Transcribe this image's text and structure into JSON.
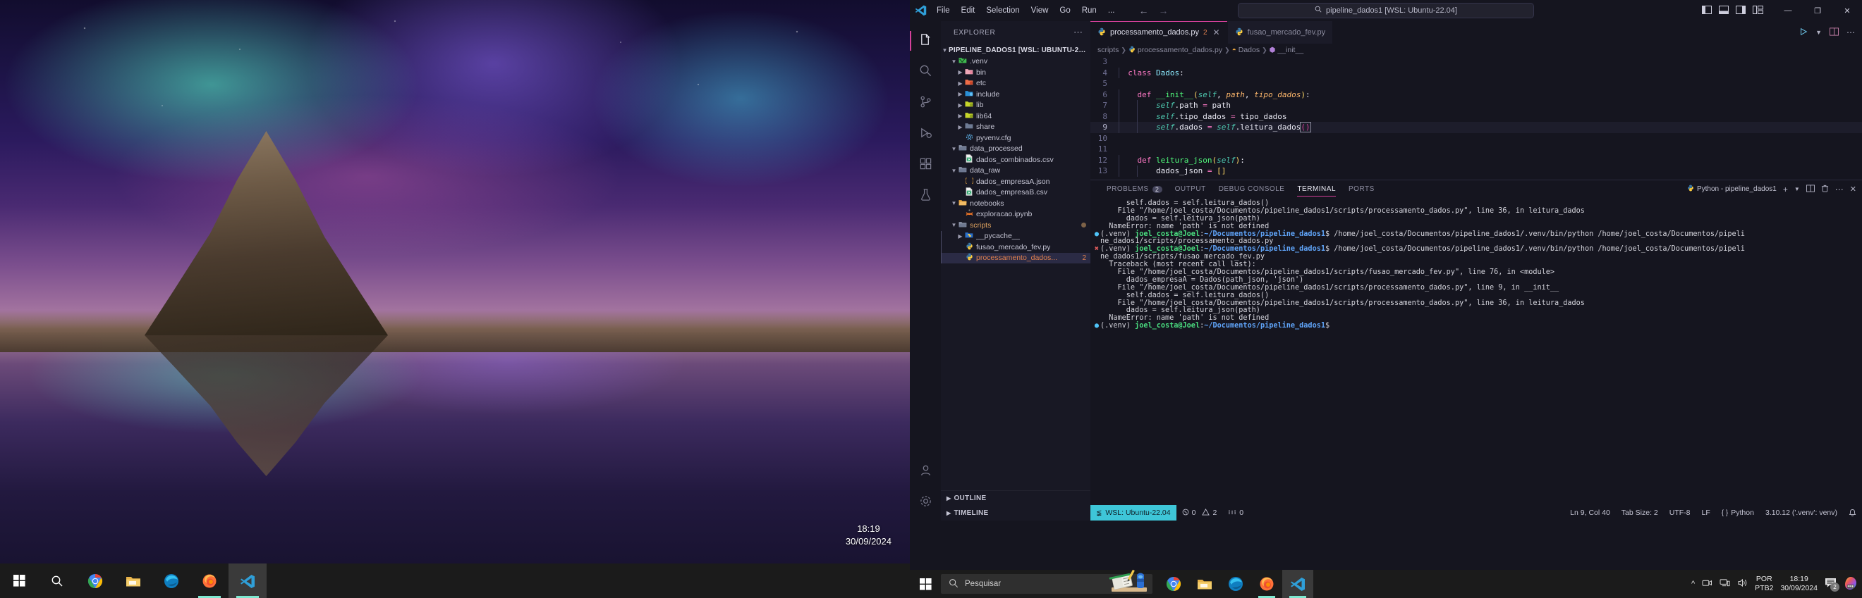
{
  "desktop": {
    "clock_time": "18:19",
    "clock_date": "30/09/2024",
    "taskbar_icons": [
      "windows-start-icon",
      "search-icon",
      "chrome-icon",
      "file-explorer-icon",
      "edge-icon",
      "firefox-icon",
      "vscode-icon"
    ]
  },
  "titlebar": {
    "menu": [
      "File",
      "Edit",
      "Selection",
      "View",
      "Go",
      "Run",
      "..."
    ],
    "search_value": "pipeline_dados1 [WSL: Ubuntu-22.04]",
    "back_icon": "arrow-left-icon",
    "forward_icon": "arrow-right-icon",
    "layout_icons": [
      "toggle-primary-sidebar-icon",
      "toggle-panel-icon",
      "toggle-secondary-sidebar-icon",
      "customize-layout-icon"
    ],
    "minimize": "—",
    "maximize": "❐",
    "close": "✕"
  },
  "activitybar": {
    "items": [
      {
        "name": "explorer",
        "icon": "files-icon",
        "active": true
      },
      {
        "name": "search",
        "icon": "search-icon",
        "active": false
      },
      {
        "name": "source-control",
        "icon": "source-control-icon",
        "active": false
      },
      {
        "name": "run-debug",
        "icon": "run-debug-icon",
        "active": false
      },
      {
        "name": "extensions",
        "icon": "extensions-icon",
        "active": false
      },
      {
        "name": "testing",
        "icon": "beaker-icon",
        "active": false
      }
    ],
    "bottom": [
      {
        "name": "accounts",
        "icon": "account-icon"
      },
      {
        "name": "settings",
        "icon": "gear-icon"
      }
    ]
  },
  "sidebar": {
    "title": "EXPLORER",
    "more_icon": "ellipsis-icon",
    "root": "PIPELINE_DADOS1 [WSL: UBUNTU-22....",
    "tree": [
      {
        "label": ".venv",
        "icon": "folder-venv",
        "indent": 1,
        "expanded": true,
        "type": "folder"
      },
      {
        "label": "bin",
        "icon": "folder-bin",
        "indent": 2,
        "expanded": false,
        "type": "folder"
      },
      {
        "label": "etc",
        "icon": "folder-etc",
        "indent": 2,
        "expanded": false,
        "type": "folder"
      },
      {
        "label": "include",
        "icon": "folder-include",
        "indent": 2,
        "expanded": false,
        "type": "folder"
      },
      {
        "label": "lib",
        "icon": "folder-lib",
        "indent": 2,
        "expanded": false,
        "type": "folder"
      },
      {
        "label": "lib64",
        "icon": "folder-lib",
        "indent": 2,
        "expanded": false,
        "type": "folder"
      },
      {
        "label": "share",
        "icon": "folder-share",
        "indent": 2,
        "expanded": false,
        "type": "folder"
      },
      {
        "label": "pyvenv.cfg",
        "icon": "gear-file-icon",
        "indent": 2,
        "type": "file"
      },
      {
        "label": "data_processed",
        "icon": "folder-open",
        "indent": 1,
        "expanded": true,
        "type": "folder"
      },
      {
        "label": "dados_combinados.csv",
        "icon": "csv-icon",
        "indent": 2,
        "type": "file"
      },
      {
        "label": "data_raw",
        "icon": "folder-open",
        "indent": 1,
        "expanded": true,
        "type": "folder"
      },
      {
        "label": "dados_empresaA.json",
        "icon": "json-icon",
        "indent": 2,
        "type": "file"
      },
      {
        "label": "dados_empresaB.csv",
        "icon": "csv-icon",
        "indent": 2,
        "type": "file"
      },
      {
        "label": "notebooks",
        "icon": "folder-notebook",
        "indent": 1,
        "expanded": true,
        "type": "folder"
      },
      {
        "label": "exploracao.ipynb",
        "icon": "jupyter-icon",
        "indent": 2,
        "type": "file"
      },
      {
        "label": "scripts",
        "icon": "folder-scripts",
        "indent": 1,
        "expanded": true,
        "type": "folder",
        "modified": true
      },
      {
        "label": "__pycache__",
        "icon": "folder-pycache",
        "indent": 2,
        "expanded": false,
        "type": "folder"
      },
      {
        "label": "fusao_mercado_fev.py",
        "icon": "python-icon",
        "indent": 2,
        "type": "file"
      },
      {
        "label": "processamento_dados...",
        "icon": "python-icon",
        "indent": 2,
        "type": "file",
        "selected": true,
        "errors": "2"
      }
    ],
    "sections": [
      {
        "label": "OUTLINE",
        "expanded": false
      },
      {
        "label": "TIMELINE",
        "expanded": false
      }
    ]
  },
  "tabs": [
    {
      "label": "processamento_dados.py",
      "icon": "python-icon",
      "badge": "2",
      "active": true,
      "close": "✕"
    },
    {
      "label": "fusao_mercado_fev.py",
      "icon": "python-icon",
      "active": false
    }
  ],
  "tabs_actions": [
    "run-python-file-icon",
    "chevron-down-icon",
    "split-editor-icon",
    "ellipsis-icon"
  ],
  "breadcrumb": [
    "scripts",
    "processamento_dados.py",
    "Dados",
    "__init__"
  ],
  "code": {
    "lines": [
      {
        "no": "3",
        "tokens": []
      },
      {
        "no": "4",
        "tokens": [
          {
            "t": "class ",
            "c": "t-kw"
          },
          {
            "t": "Dados",
            "c": "t-cls"
          },
          {
            "t": ":",
            "c": "t-pn"
          }
        ],
        "indent": "  "
      },
      {
        "no": "5",
        "tokens": []
      },
      {
        "no": "6",
        "tokens": [
          {
            "t": "def ",
            "c": "t-kw"
          },
          {
            "t": "__init__",
            "c": "t-fn"
          },
          {
            "t": "(",
            "c": "t-b1"
          },
          {
            "t": "self",
            "c": "t-self"
          },
          {
            "t": ", ",
            "c": "t-pn"
          },
          {
            "t": "path",
            "c": "t-par"
          },
          {
            "t": ", ",
            "c": "t-pn"
          },
          {
            "t": "tipo_dados",
            "c": "t-par"
          },
          {
            "t": ")",
            "c": "t-b1"
          },
          {
            "t": ":",
            "c": "t-pn"
          }
        ],
        "indent": "    "
      },
      {
        "no": "7",
        "tokens": [
          {
            "t": "self",
            "c": "t-self"
          },
          {
            "t": ".path ",
            "c": "t-pl"
          },
          {
            "t": "= ",
            "c": "t-op"
          },
          {
            "t": "path",
            "c": "t-pl"
          }
        ],
        "indent": "        "
      },
      {
        "no": "8",
        "tokens": [
          {
            "t": "self",
            "c": "t-self"
          },
          {
            "t": ".tipo_dados ",
            "c": "t-pl"
          },
          {
            "t": "= ",
            "c": "t-op"
          },
          {
            "t": "tipo_dados",
            "c": "t-pl"
          }
        ],
        "indent": "        "
      },
      {
        "no": "9",
        "tokens": [
          {
            "t": "self",
            "c": "t-self"
          },
          {
            "t": ".dados ",
            "c": "t-pl"
          },
          {
            "t": "= ",
            "c": "t-op"
          },
          {
            "t": "self",
            "c": "t-self"
          },
          {
            "t": ".leitura_dados",
            "c": "t-pl"
          }
        ],
        "indent": "        ",
        "cursor": "()",
        "current": true
      },
      {
        "no": "10",
        "tokens": []
      },
      {
        "no": "11",
        "tokens": []
      },
      {
        "no": "12",
        "tokens": [
          {
            "t": "def ",
            "c": "t-kw"
          },
          {
            "t": "leitura_json",
            "c": "t-fn"
          },
          {
            "t": "(",
            "c": "t-b1"
          },
          {
            "t": "self",
            "c": "t-self"
          },
          {
            "t": ")",
            "c": "t-b1"
          },
          {
            "t": ":",
            "c": "t-pn"
          }
        ],
        "indent": "    "
      },
      {
        "no": "13",
        "tokens": [
          {
            "t": "dados_json ",
            "c": "t-pl"
          },
          {
            "t": "= ",
            "c": "t-op"
          },
          {
            "t": "[]",
            "c": "t-b1"
          }
        ],
        "indent": "        "
      }
    ]
  },
  "panel": {
    "tabs": [
      {
        "label": "PROBLEMS",
        "badge": "2",
        "active": false
      },
      {
        "label": "OUTPUT",
        "active": false
      },
      {
        "label": "DEBUG CONSOLE",
        "active": false
      },
      {
        "label": "TERMINAL",
        "active": true
      },
      {
        "label": "PORTS",
        "active": false
      }
    ],
    "terminal_selector": "Python - pipeline_dados1",
    "actions": [
      "new-terminal-icon",
      "split-terminal-icon",
      "kill-terminal-icon",
      "ellipsis-icon",
      "close-panel-icon"
    ]
  },
  "terminal": {
    "lines": [
      {
        "gutter": "",
        "segs": [
          {
            "t": "      self.dados = self.leitura_dados()"
          }
        ]
      },
      {
        "gutter": "",
        "segs": [
          {
            "t": "    File \"/home/joel_costa/Documentos/pipeline_dados1/scripts/processamento_dados.py\", line 36, in leitura_dados"
          }
        ]
      },
      {
        "gutter": "",
        "segs": [
          {
            "t": "      dados = self.leitura_json(path)"
          }
        ]
      },
      {
        "gutter": "",
        "segs": [
          {
            "t": "  NameError: name 'path' is not defined"
          }
        ]
      },
      {
        "gutter": "ok",
        "segs": [
          {
            "t": "(.venv) ",
            "c": "t-venv"
          },
          {
            "t": "joel_costa@Joel",
            "c": "t-user"
          },
          {
            "t": ":",
            "c": ""
          },
          {
            "t": "~/Documentos/pipeline_dados1",
            "c": "t-path"
          },
          {
            "t": "$ /home/joel_costa/Documentos/pipeline_dados1/.venv/bin/python /home/joel_costa/Documentos/pipeli"
          }
        ]
      },
      {
        "gutter": "",
        "segs": [
          {
            "t": "ne_dados1/scripts/processamento_dados.py"
          }
        ]
      },
      {
        "gutter": "err",
        "segs": [
          {
            "t": "(.venv) ",
            "c": "t-venv"
          },
          {
            "t": "joel_costa@Joel",
            "c": "t-user"
          },
          {
            "t": ":",
            "c": ""
          },
          {
            "t": "~/Documentos/pipeline_dados1",
            "c": "t-path"
          },
          {
            "t": "$ /home/joel_costa/Documentos/pipeline_dados1/.venv/bin/python /home/joel_costa/Documentos/pipeli"
          }
        ]
      },
      {
        "gutter": "",
        "segs": [
          {
            "t": "ne_dados1/scripts/fusao_mercado_fev.py"
          }
        ]
      },
      {
        "gutter": "",
        "segs": [
          {
            "t": "  Traceback (most recent call last):"
          }
        ]
      },
      {
        "gutter": "",
        "segs": [
          {
            "t": "    File \"/home/joel_costa/Documentos/pipeline_dados1/scripts/fusao_mercado_fev.py\", line 76, in <module>"
          }
        ]
      },
      {
        "gutter": "",
        "segs": [
          {
            "t": "      dados_empresaA = Dados(path_json, 'json')"
          }
        ]
      },
      {
        "gutter": "",
        "segs": [
          {
            "t": "    File \"/home/joel_costa/Documentos/pipeline_dados1/scripts/processamento_dados.py\", line 9, in __init__"
          }
        ]
      },
      {
        "gutter": "",
        "segs": [
          {
            "t": "      self.dados = self.leitura_dados()"
          }
        ]
      },
      {
        "gutter": "",
        "segs": [
          {
            "t": "    File \"/home/joel_costa/Documentos/pipeline_dados1/scripts/processamento_dados.py\", line 36, in leitura_dados"
          }
        ]
      },
      {
        "gutter": "",
        "segs": [
          {
            "t": "      dados = self.leitura_json(path)"
          }
        ]
      },
      {
        "gutter": "",
        "segs": [
          {
            "t": "  NameError: name 'path' is not defined"
          }
        ]
      },
      {
        "gutter": "ok",
        "segs": [
          {
            "t": "(.venv) ",
            "c": "t-venv"
          },
          {
            "t": "joel_costa@Joel",
            "c": "t-user"
          },
          {
            "t": ":",
            "c": ""
          },
          {
            "t": "~/Documentos/pipeline_dados1",
            "c": "t-path"
          },
          {
            "t": "$"
          }
        ]
      }
    ]
  },
  "statusbar": {
    "remote": "WSL: Ubuntu-22.04",
    "errors": "0",
    "warnings": "2",
    "ports": "0",
    "cursor_position": "Ln 9, Col 40",
    "tab_size": "Tab Size: 2",
    "encoding": "UTF-8",
    "eol": "LF",
    "language": "Python",
    "interpreter": "3.10.12 ('.venv': venv)",
    "bell_icon": "bell-icon"
  },
  "win_taskbar": {
    "search_placeholder": "Pesquisar",
    "icons": [
      "chrome-icon",
      "file-explorer-icon",
      "edge-icon",
      "firefox-icon",
      "vscode-icon"
    ],
    "tray": [
      "chevron-up-icon",
      "camera-icon",
      "network-icon",
      "volume-icon"
    ],
    "lang_line1": "POR",
    "lang_line2": "PTB2",
    "time": "18:19",
    "date": "30/09/2024",
    "notification_count": "2",
    "copilot_icon": "copilot-pre-icon"
  }
}
